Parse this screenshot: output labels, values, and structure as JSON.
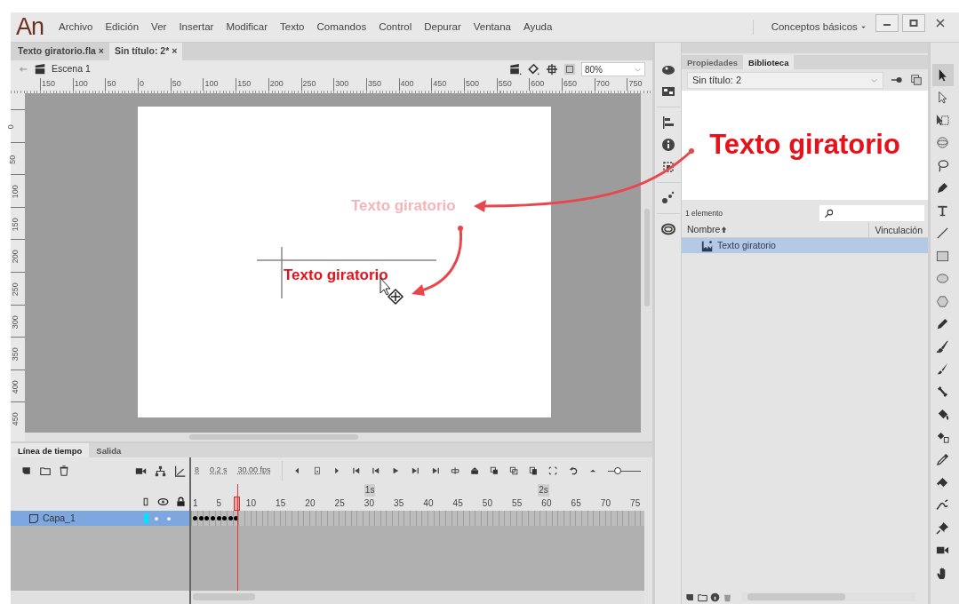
{
  "app": {
    "logo": "An",
    "menu": [
      "Archivo",
      "Edición",
      "Ver",
      "Insertar",
      "Modificar",
      "Texto",
      "Comandos",
      "Control",
      "Depurar",
      "Ventana",
      "Ayuda"
    ],
    "workspace": "Conceptos básicos"
  },
  "document_tabs": [
    {
      "label": "Texto giratorio.fla",
      "close": "×",
      "selected": false
    },
    {
      "label": "Sin título: 2*",
      "close": "×",
      "selected": true
    }
  ],
  "scene": {
    "name": "Escena 1",
    "zoom": "80%"
  },
  "ruler": {
    "horizontal": [
      "150",
      "100",
      "50",
      "0",
      "50",
      "100",
      "150",
      "200",
      "250",
      "300",
      "350",
      "400",
      "450",
      "500",
      "550",
      "600",
      "650",
      "700",
      "750"
    ],
    "vertical": [
      "0",
      "50",
      "100",
      "150",
      "200",
      "250",
      "300",
      "350",
      "400",
      "450"
    ]
  },
  "stage": {
    "ghost_text": "Texto giratorio",
    "text": "Texto giratorio"
  },
  "timeline": {
    "tabs": [
      {
        "label": "Línea de tiempo",
        "selected": true
      },
      {
        "label": "Salida",
        "selected": false
      }
    ],
    "frame": "8",
    "time": "0.2 s",
    "fps": "30.00 fps",
    "frame_numbers": [
      "1",
      "5",
      "10",
      "15",
      "20",
      "25",
      "30",
      "35",
      "40",
      "45",
      "50",
      "55",
      "60",
      "65",
      "70",
      "75"
    ],
    "seconds": [
      "1s",
      "2s"
    ],
    "zoom_slider": {
      "level": 0.3
    },
    "layers": [
      {
        "name": "Capa_1",
        "selected": true,
        "color": "#00e5ff"
      }
    ]
  },
  "library": {
    "tabs": [
      {
        "label": "Propiedades",
        "selected": false
      },
      {
        "label": "Biblioteca",
        "selected": true
      }
    ],
    "document": "Sin título: 2",
    "preview": "Texto giratorio",
    "count": "1 elemento",
    "columns": [
      "Nombre",
      "Vinculación"
    ],
    "items": [
      {
        "name": "Texto giratorio",
        "selected": true
      }
    ]
  },
  "tools": [
    {
      "kind": "selection",
      "selected": true
    },
    {
      "kind": "subselection",
      "selected": false
    },
    {
      "kind": "free-transform",
      "selected": false
    },
    {
      "kind": "rotation-3d",
      "selected": false
    },
    {
      "kind": "lasso",
      "selected": false
    },
    {
      "kind": "pen",
      "selected": false
    },
    {
      "kind": "text",
      "selected": false
    },
    {
      "kind": "line",
      "selected": false
    },
    {
      "kind": "rectangle",
      "selected": false
    },
    {
      "kind": "oval",
      "selected": false
    },
    {
      "kind": "polygon",
      "selected": false
    },
    {
      "kind": "pencil",
      "selected": false
    },
    {
      "kind": "paint-brush",
      "selected": false
    },
    {
      "kind": "brush",
      "selected": false
    },
    {
      "kind": "bone",
      "selected": false
    },
    {
      "kind": "paint-bucket",
      "selected": false
    },
    {
      "kind": "ink-bottle",
      "selected": false
    },
    {
      "kind": "eyedropper",
      "selected": false
    },
    {
      "kind": "eraser",
      "selected": false
    },
    {
      "kind": "width",
      "selected": false
    },
    {
      "kind": "pin",
      "selected": false
    },
    {
      "kind": "camera",
      "selected": false
    },
    {
      "kind": "hand",
      "selected": false
    }
  ]
}
